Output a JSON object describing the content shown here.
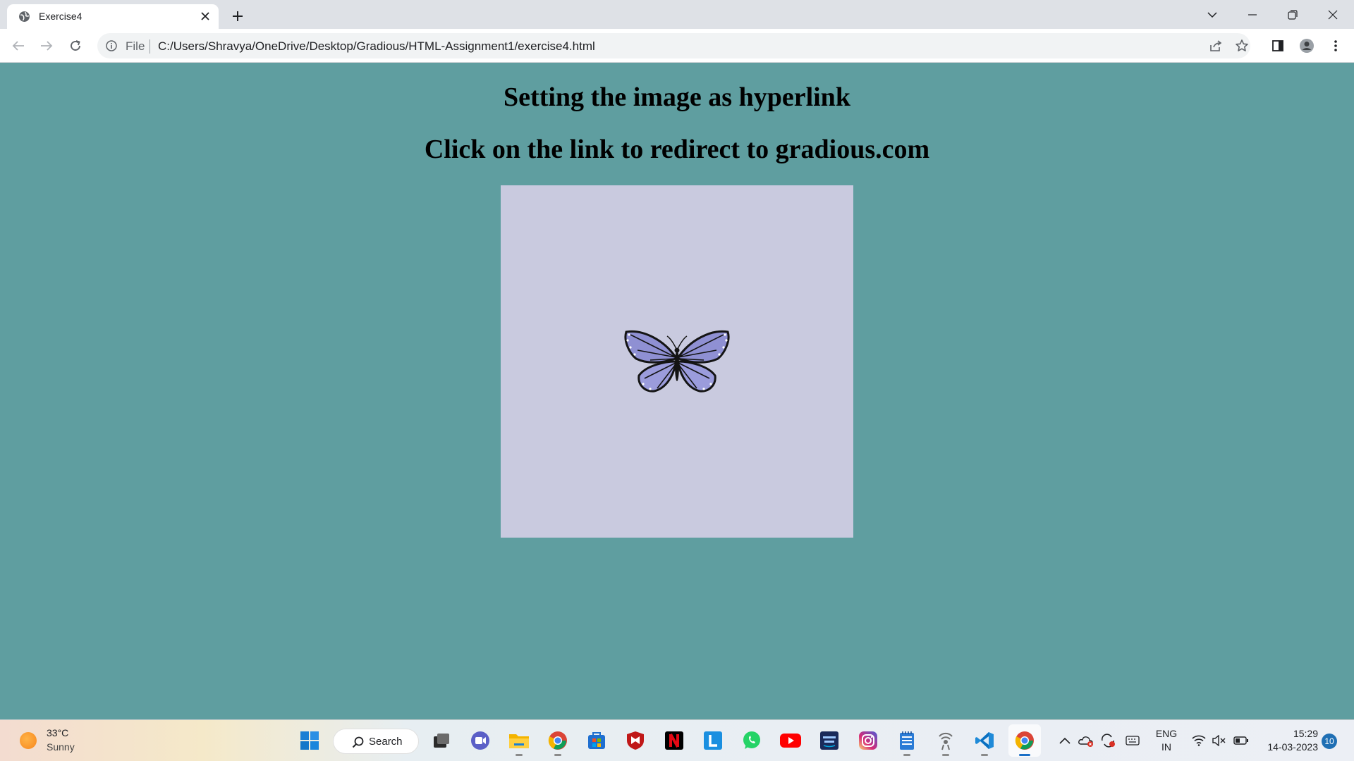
{
  "browser": {
    "tab": {
      "title": "Exercise4"
    },
    "address": {
      "scheme_label": "File",
      "url": "C:/Users/Shravya/OneDrive/Desktop/Gradious/HTML-Assignment1/exercise4.html"
    }
  },
  "page": {
    "heading1": "Setting the image as hyperlink",
    "heading2": "Click on the link to redirect to gradious.com",
    "image": {
      "subject": "butterfly",
      "background": "#c9cadf"
    },
    "background_color": "#5f9ea0"
  },
  "taskbar": {
    "weather": {
      "temp": "33°C",
      "condition": "Sunny"
    },
    "search_label": "Search",
    "apps": [
      "start-icon",
      "search",
      "task-view-icon",
      "teams-icon",
      "file-explorer-icon",
      "chrome-icon",
      "store-icon",
      "mcafee-icon",
      "netflix-icon",
      "letter-l-icon",
      "whatsapp-icon",
      "youtube-icon",
      "prime-video-icon",
      "instagram-icon",
      "notepad-icon",
      "wifi-signal-icon",
      "vscode-icon",
      "chrome-icon"
    ],
    "tray": {
      "lang_top": "ENG",
      "lang_bottom": "IN",
      "time": "15:29",
      "date": "14-03-2023",
      "notification_count": "10"
    }
  }
}
